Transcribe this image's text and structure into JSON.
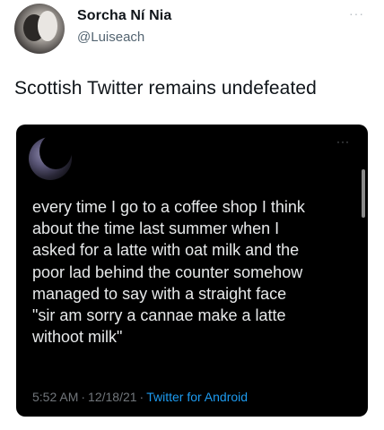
{
  "tweet": {
    "display_name": "Sorcha Ní Nia",
    "handle": "@Luiseach",
    "more_icon": "more-horizontal-icon",
    "text": "Scottish Twitter remains undefeated"
  },
  "quoted_tweet": {
    "more_icon": "more-horizontal-icon",
    "text": "every time I go to a coffee shop I think\nabout the time last summer when I\nasked for a latte with oat milk and the\npoor lad behind the counter somehow\nmanaged to say with a straight face\n\"sir am sorry a cannae make a latte\nwithoot milk\"",
    "time": "5:52 AM",
    "date": "12/18/21",
    "client": "Twitter for Android",
    "separator": "·"
  },
  "colors": {
    "name": "#0f1419",
    "handle": "#536471",
    "embedded_bg": "#000000",
    "embedded_text": "#e7e9ea",
    "link": "#1d9bf0"
  }
}
